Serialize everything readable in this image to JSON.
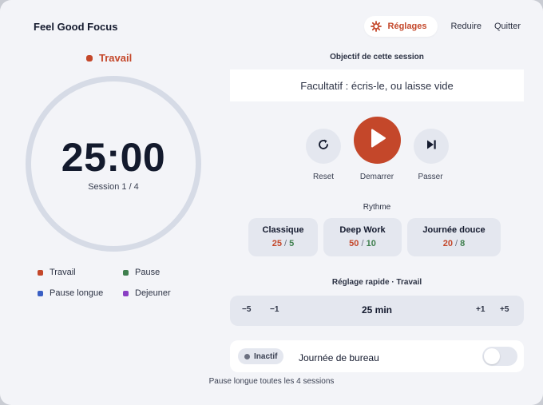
{
  "app": {
    "title": "Feel Good Focus"
  },
  "nav": {
    "settings": "Réglages",
    "reduce": "Reduire",
    "quit": "Quitter"
  },
  "mode": {
    "label": "Travail",
    "color": "#c4472a"
  },
  "timer": {
    "time": "25:00",
    "session": "Session 1 / 4"
  },
  "legend": [
    {
      "label": "Travail",
      "color": "#c4472a"
    },
    {
      "label": "Pause",
      "color": "#3f7f4e"
    },
    {
      "label": "Pause longue",
      "color": "#3a5fc4"
    },
    {
      "label": "Dejeuner",
      "color": "#8a3fc4"
    }
  ],
  "goal": {
    "label": "Objectif de cette session",
    "placeholder": "Facultatif : écris-le, ou laisse vide",
    "value": ""
  },
  "controls": {
    "reset": "Reset",
    "start": "Demarrer",
    "skip": "Passer"
  },
  "rhythm": {
    "label": "Rythme",
    "presets": [
      {
        "name": "Classique",
        "work": "25",
        "break": "5"
      },
      {
        "name": "Deep Work",
        "work": "50",
        "break": "10"
      },
      {
        "name": "Journée douce",
        "work": "20",
        "break": "8"
      }
    ],
    "separator": "/"
  },
  "quick": {
    "label": "Réglage rapide · Travail",
    "minus5": "−5",
    "minus1": "−1",
    "value": "25 min",
    "plus1": "+1",
    "plus5": "+5"
  },
  "office": {
    "status": "Inactif",
    "label": "Journée de bureau",
    "enabled": false
  },
  "footer": "Pause longue toutes les 4 sessions",
  "colors": {
    "accent": "#c4472a",
    "break": "#3f7f4e",
    "panel": "#e4e7ef",
    "background": "#f3f4f8"
  }
}
